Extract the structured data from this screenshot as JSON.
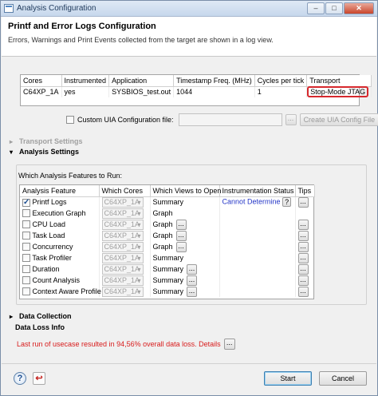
{
  "window": {
    "title": "Analysis Configuration",
    "btn_min": "–",
    "btn_max": "□",
    "btn_close": "✕"
  },
  "header": {
    "title": "Printf and Error Logs Configuration",
    "subtitle": "Errors, Warnings and Print Events collected from the target are shown in a log view."
  },
  "cores_table": {
    "columns": [
      "Cores",
      "Instrumented",
      "Application",
      "Timestamp Freq. (MHz)",
      "Cycles per tick",
      "Transport"
    ],
    "rows": [
      [
        "C64XP_1A",
        "yes",
        "SYSBIOS_test.out",
        "1044",
        "1",
        "Stop-Mode JTAG"
      ]
    ]
  },
  "custom_uia": {
    "label": "Custom UIA Configuration file:",
    "value": "",
    "browse": "...",
    "create": "Create UIA Config File",
    "checked": false
  },
  "sections": {
    "transport": "Transport Settings",
    "analysis": "Analysis Settings",
    "data_collection": "Data Collection",
    "data_loss": "Data Loss Info"
  },
  "features": {
    "group_title": "Which Analysis Features to Run:",
    "columns": [
      "Analysis Feature",
      "Which Cores",
      "Which Views to Open",
      "Instrumentation Status",
      "Tips"
    ],
    "rows": [
      {
        "name": "Printf Logs",
        "checked": true,
        "core": "C64XP_1A",
        "view": "Summary",
        "view_btn": false,
        "status": "Cannot Determine",
        "tips": "..."
      },
      {
        "name": "Execution Graph",
        "checked": false,
        "core": "C64XP_1A",
        "view": "Graph",
        "view_btn": false,
        "status": "",
        "tips": ""
      },
      {
        "name": "CPU Load",
        "checked": false,
        "core": "C64XP_1A",
        "view": "Graph",
        "view_btn": true,
        "status": "",
        "tips": "..."
      },
      {
        "name": "Task Load",
        "checked": false,
        "core": "C64XP_1A",
        "view": "Graph",
        "view_btn": true,
        "status": "",
        "tips": "..."
      },
      {
        "name": "Concurrency",
        "checked": false,
        "core": "C64XP_1A",
        "view": "Graph",
        "view_btn": true,
        "status": "",
        "tips": "..."
      },
      {
        "name": "Task Profiler",
        "checked": false,
        "core": "C64XP_1A",
        "view": "Summary",
        "view_btn": false,
        "status": "",
        "tips": "..."
      },
      {
        "name": "Duration",
        "checked": false,
        "core": "C64XP_1A",
        "view": "Summary",
        "view_btn": true,
        "status": "",
        "tips": "..."
      },
      {
        "name": "Count Analysis",
        "checked": false,
        "core": "C64XP_1A",
        "view": "Summary",
        "view_btn": true,
        "status": "",
        "tips": "..."
      },
      {
        "name": "Context Aware Profile",
        "checked": false,
        "core": "C64XP_1A",
        "view": "Summary",
        "view_btn": true,
        "status": "",
        "tips": "..."
      }
    ],
    "status_help": "?"
  },
  "data_loss": {
    "message": "Last run of usecase resulted in 94,56% overall data loss. Details",
    "details_btn": "..."
  },
  "footer": {
    "start": "Start",
    "cancel": "Cancel",
    "help_glyph": "?",
    "import_glyph": "↩"
  }
}
